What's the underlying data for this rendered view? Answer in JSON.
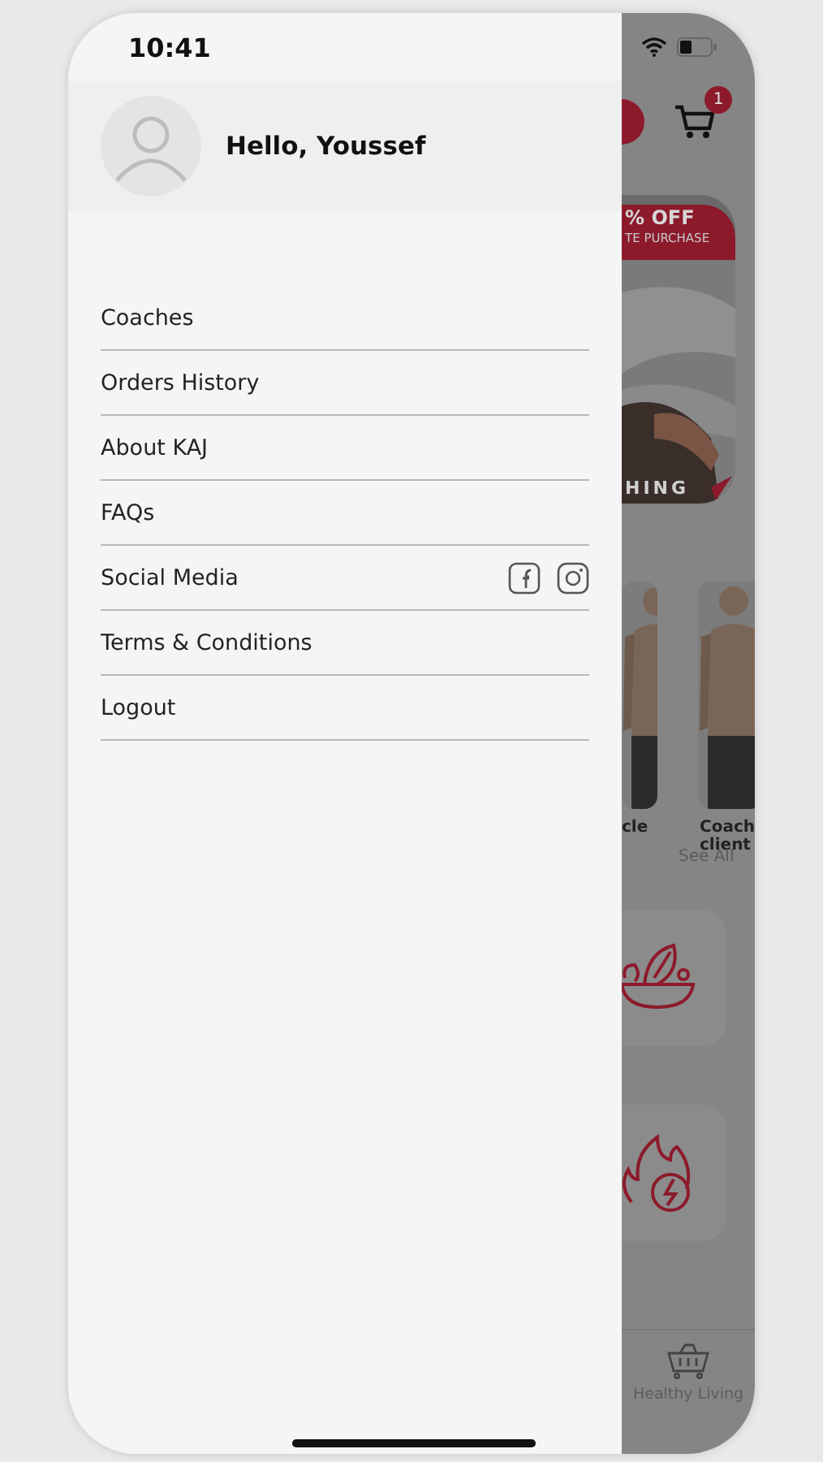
{
  "status_bar": {
    "time": "10:41"
  },
  "drawer": {
    "greeting": "Hello, Youssef",
    "menu": [
      {
        "label": "Coaches",
        "kind": "link"
      },
      {
        "label": "Orders History",
        "kind": "link"
      },
      {
        "label": "About KAJ",
        "kind": "link"
      },
      {
        "label": "FAQs",
        "kind": "link"
      },
      {
        "label": "Social Media",
        "kind": "social"
      },
      {
        "label": "Terms & Conditions",
        "kind": "link"
      },
      {
        "label": "Logout",
        "kind": "link"
      }
    ]
  },
  "background_screen": {
    "cart_count": "1",
    "banner": {
      "discount": "% OFF",
      "subtitle": "TE PURCHASE",
      "footer": "HING"
    },
    "cards": [
      {
        "caption_lines": [
          "cle"
        ]
      },
      {
        "caption_lines": [
          "Coach",
          "client"
        ]
      }
    ],
    "see_all": "See All",
    "categories": [
      {
        "kind": "salad"
      },
      {
        "kind": "fire"
      }
    ],
    "nav": {
      "label": "Healthy Living"
    }
  }
}
